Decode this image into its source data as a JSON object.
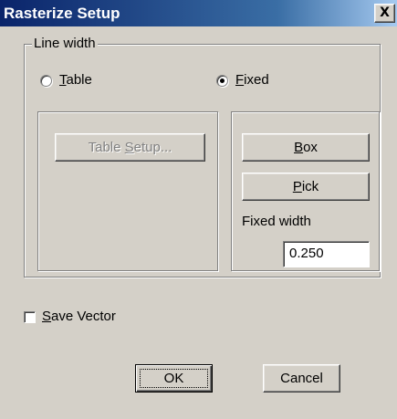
{
  "window": {
    "title": "Rasterize Setup",
    "close_glyph": "X"
  },
  "line_width_group": {
    "legend": "Line width",
    "table_option": {
      "mnemonic": "T",
      "rest": "able",
      "checked": false
    },
    "fixed_option": {
      "mnemonic": "F",
      "rest": "ixed",
      "checked": true
    }
  },
  "table_panel": {
    "setup_button": {
      "before": "Table ",
      "mnemonic": "S",
      "after": "etup...",
      "enabled": false
    }
  },
  "fixed_panel": {
    "box_button": {
      "mnemonic": "B",
      "rest": "ox"
    },
    "pick_button": {
      "mnemonic": "P",
      "rest": "ick"
    },
    "fixed_width_label": "Fixed width",
    "fixed_width_value": "0.250"
  },
  "save_vector": {
    "mnemonic": "S",
    "rest": "ave Vector",
    "checked": false
  },
  "footer": {
    "ok_label": "OK",
    "cancel_label": "Cancel"
  },
  "colors": {
    "face": "#d4d0c8",
    "titlebar_start": "#0a246a",
    "titlebar_end": "#a6caf0",
    "disabled_text": "#808080"
  }
}
